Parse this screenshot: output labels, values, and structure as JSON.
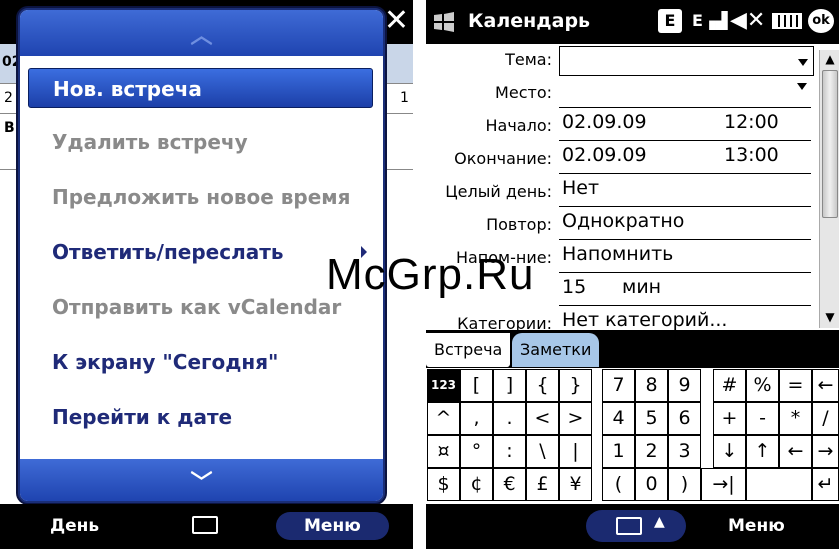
{
  "left": {
    "close_icon": "close-icon",
    "bg_cells": [
      "02",
      "2",
      "1",
      "В"
    ],
    "menu": {
      "items": [
        {
          "label": "Нов. встреча",
          "state": "selected"
        },
        {
          "label": "Удалить встречу",
          "state": "disabled"
        },
        {
          "label": "Предложить новое время",
          "state": "disabled"
        },
        {
          "label": "Ответить/переслать",
          "state": "enabled"
        },
        {
          "label": "Отправить как  vCalendar",
          "state": "disabled"
        },
        {
          "label": "К экрану \"Сегодня\"",
          "state": "enabled"
        },
        {
          "label": "Перейти к дате",
          "state": "enabled"
        }
      ]
    },
    "softkeys": {
      "left": "День",
      "right": "Меню"
    }
  },
  "right": {
    "title": "Календарь",
    "status": {
      "e1": "E",
      "e2": "E",
      "battery_icon": "battery-icon",
      "close": "ok-icon"
    },
    "form": {
      "subject_label": "Тема:",
      "subject_value": "",
      "location_label": "Место:",
      "location_value": "",
      "start_label": "Начало:",
      "start_date": "02.09.09",
      "start_time": "12:00",
      "end_label": "Окончание:",
      "end_date": "02.09.09",
      "end_time": "13:00",
      "allday_label": "Целый день:",
      "allday_value": "Нет",
      "repeat_label": "Повтор:",
      "repeat_value": "Однократно",
      "reminder_label": "Напом-ние:",
      "reminder_value": "Напомнить",
      "reminder_amount": "15",
      "reminder_unit": "мин",
      "categories_label": "Категории:",
      "categories_value": "Нет категорий..."
    },
    "tabs": [
      "Встреча",
      "Заметки"
    ],
    "keyboard": {
      "rows": [
        [
          "123",
          "[",
          "]",
          "{",
          "}",
          "7",
          "8",
          "9",
          "#",
          "%",
          "=",
          "←"
        ],
        [
          "^",
          ",",
          ".",
          "<",
          ">",
          "4",
          "5",
          "6",
          "+",
          "-",
          "*",
          "/"
        ],
        [
          "¤",
          "°",
          ":",
          "\\",
          "|",
          "1",
          "2",
          "3",
          "↓",
          "↑",
          "←",
          "→"
        ],
        [
          "$",
          "¢",
          "€",
          "£",
          "¥",
          "(",
          "0",
          ")",
          "→|",
          "",
          "↵"
        ]
      ]
    },
    "softkeys": {
      "right": "Меню"
    }
  },
  "watermark": "McGrp.Ru"
}
